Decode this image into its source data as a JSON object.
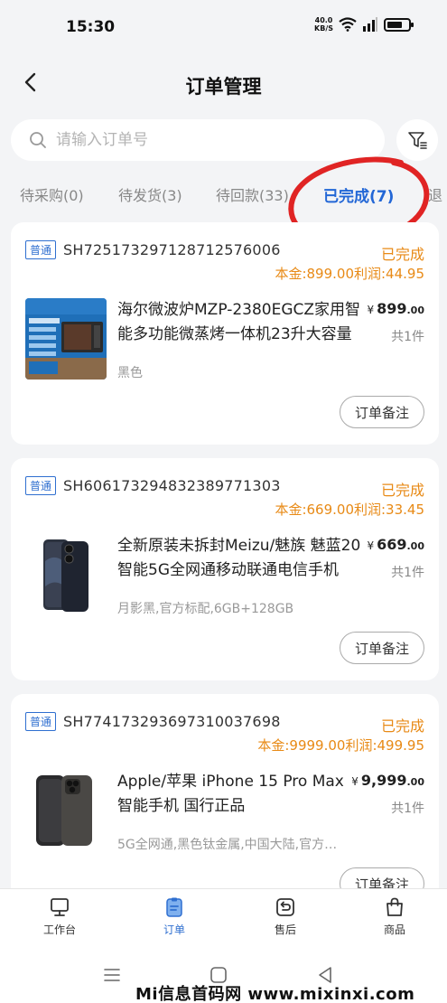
{
  "status_bar": {
    "time": "15:30",
    "net_speed_value": "40.0",
    "net_speed_unit": "KB/S"
  },
  "header": {
    "title": "订单管理"
  },
  "search": {
    "placeholder": "请输入订单号"
  },
  "tabs": [
    {
      "label": "待采购(0)",
      "active": false
    },
    {
      "label": "待发货(3)",
      "active": false
    },
    {
      "label": "待回款(33)",
      "active": false
    },
    {
      "label": "已完成(7)",
      "active": true
    },
    {
      "label": "退",
      "active": false
    }
  ],
  "orders": [
    {
      "badge": "普通",
      "order_no": "SH725173297128712576006",
      "status": "已完成",
      "amount_line": "本金:899.00利润:44.95",
      "product_name": "海尔微波炉MZP-2380EGCZ家用智能多功能微蒸烤一体机23升大容量",
      "price_currency": "¥",
      "price_int": "899",
      "price_dec": ".00",
      "qty": "共1件",
      "spec": "黑色",
      "note_button": "订单备注",
      "thumb_icon": "microwave-image"
    },
    {
      "badge": "普通",
      "order_no": "SH606173294832389771303",
      "status": "已完成",
      "amount_line": "本金:669.00利润:33.45",
      "product_name": "全新原装未拆封Meizu/魅族 魅蓝20智能5G全网通移动联通电信手机",
      "price_currency": "¥",
      "price_int": "669",
      "price_dec": ".00",
      "qty": "共1件",
      "spec": "月影黑,官方标配,6GB+128GB",
      "note_button": "订单备注",
      "thumb_icon": "meizu-phone-image"
    },
    {
      "badge": "普通",
      "order_no": "SH774173293697310037698",
      "status": "已完成",
      "amount_line": "本金:9999.00利润:499.95",
      "product_name": "Apple/苹果 iPhone 15 Pro Max 智能手机 国行正品",
      "price_currency": "¥",
      "price_int": "9,999",
      "price_dec": ".00",
      "qty": "共1件",
      "spec": "5G全网通,黑色钛金属,中国大陆,官方…",
      "note_button": "订单备注",
      "thumb_icon": "iphone-image"
    }
  ],
  "tabbar": [
    {
      "label": "工作台",
      "icon": "workbench-icon",
      "active": false
    },
    {
      "label": "订单",
      "icon": "order-icon",
      "active": true
    },
    {
      "label": "售后",
      "icon": "after-sales-icon",
      "active": false
    },
    {
      "label": "商品",
      "icon": "product-bag-icon",
      "active": false
    }
  ],
  "watermark": "Mi信息首码网 www.mixinxi.com",
  "colors": {
    "accent": "#2367d6",
    "status": "#e88a16",
    "annotation": "#e02424"
  }
}
